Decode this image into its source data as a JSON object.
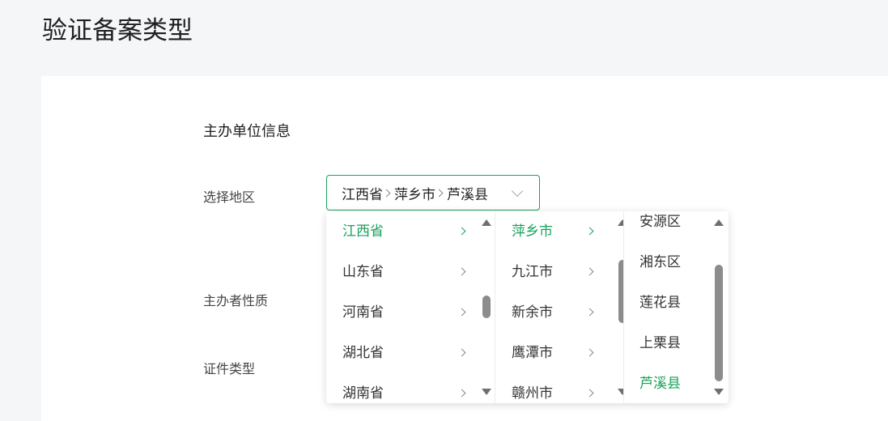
{
  "page": {
    "title": "验证备案类型"
  },
  "section": {
    "title": "主办单位信息"
  },
  "form": {
    "region_label": "选择地区",
    "nature_label": "主办者性质",
    "cert_label": "证件类型"
  },
  "cascader": {
    "path": [
      "江西省",
      "萍乡市",
      "芦溪县"
    ],
    "provinces": [
      "江西省",
      "山东省",
      "河南省",
      "湖北省",
      "湖南省"
    ],
    "cities": [
      "萍乡市",
      "九江市",
      "新余市",
      "鹰潭市",
      "赣州市"
    ],
    "districts": [
      "安源区",
      "湘东区",
      "莲花县",
      "上栗县",
      "芦溪县"
    ],
    "active_province": "江西省",
    "active_city": "萍乡市",
    "active_district": "芦溪县"
  },
  "colors": {
    "accent": "#1aa15c",
    "background": "#f5f6f8"
  }
}
